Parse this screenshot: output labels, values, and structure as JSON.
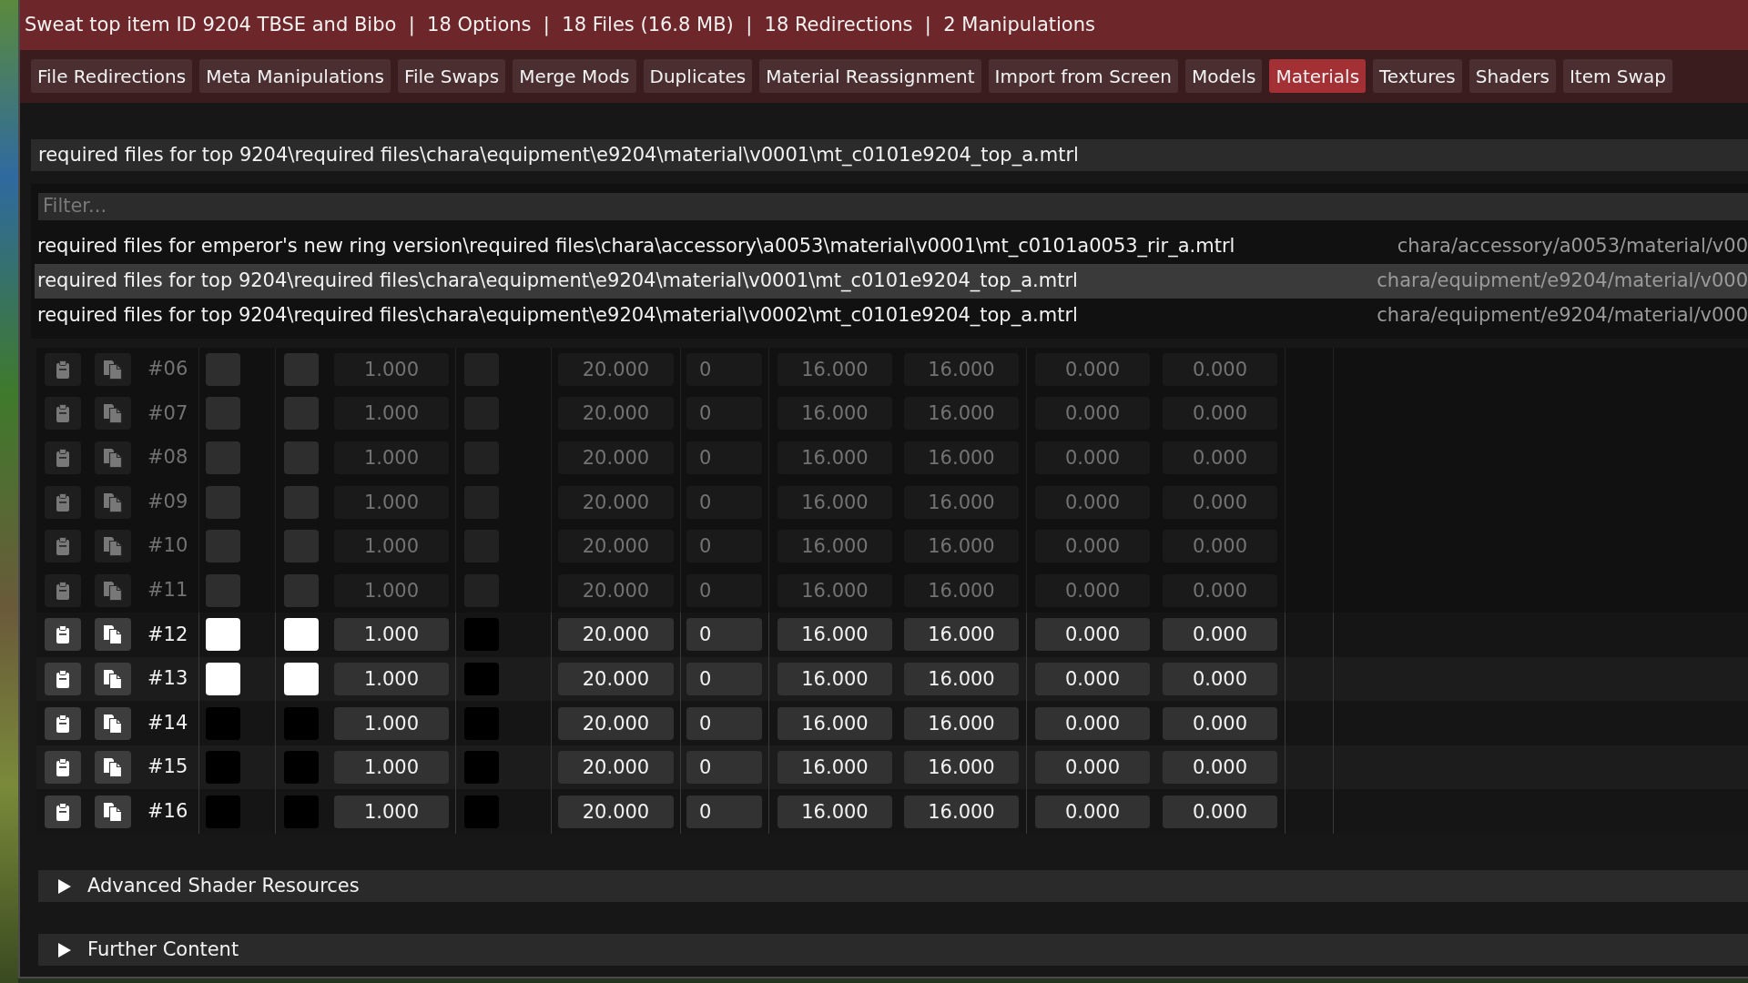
{
  "window": {
    "title": "Sweat top item ID 9204 TBSE and Bibo  |  18 Options  |  18 Files (16.8 MB)  |  18 Redirections  |  2 Manipulations"
  },
  "tabs": [
    {
      "label": "File Redirections",
      "selected": false
    },
    {
      "label": "Meta Manipulations",
      "selected": false
    },
    {
      "label": "File Swaps",
      "selected": false
    },
    {
      "label": "Merge Mods",
      "selected": false
    },
    {
      "label": "Duplicates",
      "selected": false
    },
    {
      "label": "Material Reassignment",
      "selected": false
    },
    {
      "label": "Import from Screen",
      "selected": false
    },
    {
      "label": "Models",
      "selected": false
    },
    {
      "label": "Materials",
      "selected": true
    },
    {
      "label": "Textures",
      "selected": false
    },
    {
      "label": "Shaders",
      "selected": false
    },
    {
      "label": "Item Swap",
      "selected": false
    }
  ],
  "file_dropdown": {
    "value": "required files for top 9204\\required files\\chara\\equipment\\e9204\\material\\v0001\\mt_c0101e9204_top_a.mtrl"
  },
  "dropdown_popup": {
    "filter": {
      "placeholder": "Filter..."
    },
    "options": [
      {
        "label": "required files for emperor's new ring version\\required files\\chara\\accessory\\a0053\\material\\v0001\\mt_c0101a0053_rir_a.mtrl",
        "game_path": "chara/accessory/a0053/material/v00",
        "selected": false
      },
      {
        "label": "required files for top 9204\\required files\\chara\\equipment\\e9204\\material\\v0001\\mt_c0101e9204_top_a.mtrl",
        "game_path": "chara/equipment/e9204/material/v000",
        "selected": true
      },
      {
        "label": "required files for top 9204\\required files\\chara\\equipment\\e9204\\material\\v0002\\mt_c0101e9204_top_a.mtrl",
        "game_path": "chara/equipment/e9204/material/v000",
        "selected": false
      }
    ]
  },
  "material_rows": [
    {
      "number": "#06",
      "dimmed": true,
      "cells": [
        {
          "kind": "swatch",
          "color": "#2e2e2e"
        },
        {
          "kind": "swatch",
          "color": "#2e2e2e"
        },
        {
          "kind": "float",
          "value": "1.000"
        },
        {
          "kind": "swatch",
          "color": "#222222"
        },
        {
          "kind": "float",
          "value": "20.000"
        },
        {
          "kind": "int",
          "value": "0"
        },
        {
          "kind": "float",
          "value": "16.000"
        },
        {
          "kind": "float",
          "value": "16.000"
        },
        {
          "kind": "float",
          "value": "0.000"
        },
        {
          "kind": "float",
          "value": "0.000"
        }
      ]
    },
    {
      "number": "#07",
      "dimmed": true,
      "cells": [
        {
          "kind": "swatch",
          "color": "#2e2e2e"
        },
        {
          "kind": "swatch",
          "color": "#2e2e2e"
        },
        {
          "kind": "float",
          "value": "1.000"
        },
        {
          "kind": "swatch",
          "color": "#222222"
        },
        {
          "kind": "float",
          "value": "20.000"
        },
        {
          "kind": "int",
          "value": "0"
        },
        {
          "kind": "float",
          "value": "16.000"
        },
        {
          "kind": "float",
          "value": "16.000"
        },
        {
          "kind": "float",
          "value": "0.000"
        },
        {
          "kind": "float",
          "value": "0.000"
        }
      ]
    },
    {
      "number": "#08",
      "dimmed": true,
      "cells": [
        {
          "kind": "swatch",
          "color": "#2e2e2e"
        },
        {
          "kind": "swatch",
          "color": "#2e2e2e"
        },
        {
          "kind": "float",
          "value": "1.000"
        },
        {
          "kind": "swatch",
          "color": "#222222"
        },
        {
          "kind": "float",
          "value": "20.000"
        },
        {
          "kind": "int",
          "value": "0"
        },
        {
          "kind": "float",
          "value": "16.000"
        },
        {
          "kind": "float",
          "value": "16.000"
        },
        {
          "kind": "float",
          "value": "0.000"
        },
        {
          "kind": "float",
          "value": "0.000"
        }
      ]
    },
    {
      "number": "#09",
      "dimmed": true,
      "cells": [
        {
          "kind": "swatch",
          "color": "#2e2e2e"
        },
        {
          "kind": "swatch",
          "color": "#2e2e2e"
        },
        {
          "kind": "float",
          "value": "1.000"
        },
        {
          "kind": "swatch",
          "color": "#222222"
        },
        {
          "kind": "float",
          "value": "20.000"
        },
        {
          "kind": "int",
          "value": "0"
        },
        {
          "kind": "float",
          "value": "16.000"
        },
        {
          "kind": "float",
          "value": "16.000"
        },
        {
          "kind": "float",
          "value": "0.000"
        },
        {
          "kind": "float",
          "value": "0.000"
        }
      ]
    },
    {
      "number": "#10",
      "dimmed": true,
      "cells": [
        {
          "kind": "swatch",
          "color": "#2e2e2e"
        },
        {
          "kind": "swatch",
          "color": "#2e2e2e"
        },
        {
          "kind": "float",
          "value": "1.000"
        },
        {
          "kind": "swatch",
          "color": "#222222"
        },
        {
          "kind": "float",
          "value": "20.000"
        },
        {
          "kind": "int",
          "value": "0"
        },
        {
          "kind": "float",
          "value": "16.000"
        },
        {
          "kind": "float",
          "value": "16.000"
        },
        {
          "kind": "float",
          "value": "0.000"
        },
        {
          "kind": "float",
          "value": "0.000"
        }
      ]
    },
    {
      "number": "#11",
      "dimmed": true,
      "cells": [
        {
          "kind": "swatch",
          "color": "#2e2e2e"
        },
        {
          "kind": "swatch",
          "color": "#2e2e2e"
        },
        {
          "kind": "float",
          "value": "1.000"
        },
        {
          "kind": "swatch",
          "color": "#222222"
        },
        {
          "kind": "float",
          "value": "20.000"
        },
        {
          "kind": "int",
          "value": "0"
        },
        {
          "kind": "float",
          "value": "16.000"
        },
        {
          "kind": "float",
          "value": "16.000"
        },
        {
          "kind": "float",
          "value": "0.000"
        },
        {
          "kind": "float",
          "value": "0.000"
        }
      ]
    },
    {
      "number": "#12",
      "dimmed": false,
      "cells": [
        {
          "kind": "swatch",
          "color": "#ffffff"
        },
        {
          "kind": "swatch",
          "color": "#ffffff"
        },
        {
          "kind": "float",
          "value": "1.000"
        },
        {
          "kind": "swatch",
          "color": "#000000"
        },
        {
          "kind": "float",
          "value": "20.000"
        },
        {
          "kind": "int",
          "value": "0"
        },
        {
          "kind": "float",
          "value": "16.000"
        },
        {
          "kind": "float",
          "value": "16.000"
        },
        {
          "kind": "float",
          "value": "0.000"
        },
        {
          "kind": "float",
          "value": "0.000"
        }
      ]
    },
    {
      "number": "#13",
      "dimmed": false,
      "cells": [
        {
          "kind": "swatch",
          "color": "#ffffff"
        },
        {
          "kind": "swatch",
          "color": "#ffffff"
        },
        {
          "kind": "float",
          "value": "1.000"
        },
        {
          "kind": "swatch",
          "color": "#000000"
        },
        {
          "kind": "float",
          "value": "20.000"
        },
        {
          "kind": "int",
          "value": "0"
        },
        {
          "kind": "float",
          "value": "16.000"
        },
        {
          "kind": "float",
          "value": "16.000"
        },
        {
          "kind": "float",
          "value": "0.000"
        },
        {
          "kind": "float",
          "value": "0.000"
        }
      ]
    },
    {
      "number": "#14",
      "dimmed": false,
      "cells": [
        {
          "kind": "swatch",
          "color": "#000000"
        },
        {
          "kind": "swatch",
          "color": "#000000"
        },
        {
          "kind": "float",
          "value": "1.000"
        },
        {
          "kind": "swatch",
          "color": "#000000"
        },
        {
          "kind": "float",
          "value": "20.000"
        },
        {
          "kind": "int",
          "value": "0"
        },
        {
          "kind": "float",
          "value": "16.000"
        },
        {
          "kind": "float",
          "value": "16.000"
        },
        {
          "kind": "float",
          "value": "0.000"
        },
        {
          "kind": "float",
          "value": "0.000"
        }
      ]
    },
    {
      "number": "#15",
      "dimmed": false,
      "cells": [
        {
          "kind": "swatch",
          "color": "#000000"
        },
        {
          "kind": "swatch",
          "color": "#000000"
        },
        {
          "kind": "float",
          "value": "1.000"
        },
        {
          "kind": "swatch",
          "color": "#000000"
        },
        {
          "kind": "float",
          "value": "20.000"
        },
        {
          "kind": "int",
          "value": "0"
        },
        {
          "kind": "float",
          "value": "16.000"
        },
        {
          "kind": "float",
          "value": "16.000"
        },
        {
          "kind": "float",
          "value": "0.000"
        },
        {
          "kind": "float",
          "value": "0.000"
        }
      ]
    },
    {
      "number": "#16",
      "dimmed": false,
      "cells": [
        {
          "kind": "swatch",
          "color": "#000000"
        },
        {
          "kind": "swatch",
          "color": "#000000"
        },
        {
          "kind": "float",
          "value": "1.000"
        },
        {
          "kind": "swatch",
          "color": "#000000"
        },
        {
          "kind": "float",
          "value": "20.000"
        },
        {
          "kind": "int",
          "value": "0"
        },
        {
          "kind": "float",
          "value": "16.000"
        },
        {
          "kind": "float",
          "value": "16.000"
        },
        {
          "kind": "float",
          "value": "0.000"
        },
        {
          "kind": "float",
          "value": "0.000"
        }
      ]
    }
  ],
  "sections": [
    {
      "label": "Advanced Shader Resources",
      "expanded": false
    },
    {
      "label": "Further Content",
      "expanded": false
    }
  ]
}
